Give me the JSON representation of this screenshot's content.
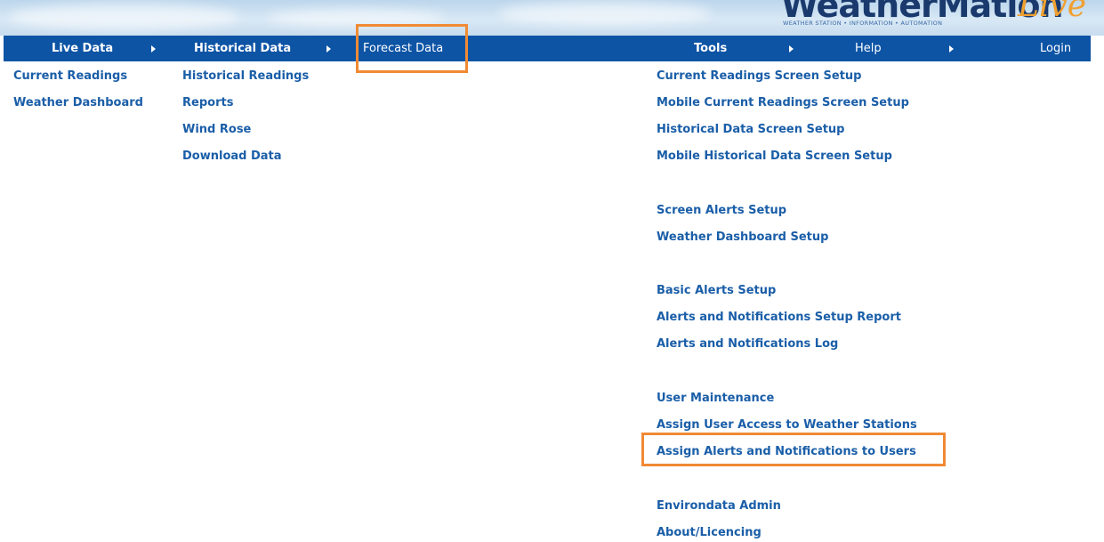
{
  "logo": {
    "main": "WeatherMation",
    "live": "Live",
    "tagline": "WEATHER STATION • INFORMATION • AUTOMATION"
  },
  "navbar": {
    "live_data": "Live Data",
    "historical_data": "Historical Data",
    "forecast_data": "Forecast Data",
    "tools": "Tools",
    "help": "Help",
    "login": "Login"
  },
  "live_data_menu": [
    "Current Readings",
    "Weather Dashboard"
  ],
  "historical_menu": [
    "Historical Readings",
    "Reports",
    "Wind Rose",
    "Download Data"
  ],
  "tools_menu": [
    "Current Readings Screen Setup",
    "Mobile Current Readings Screen Setup",
    "Historical Data Screen Setup",
    "Mobile Historical Data Screen Setup",
    "Screen Alerts Setup",
    "Weather Dashboard Setup",
    "Basic Alerts Setup",
    "Alerts and Notifications Setup Report",
    "Alerts and Notifications Log",
    "User Maintenance",
    "Assign User Access to Weather Stations",
    "Assign Alerts and Notifications to Users",
    "Environdata Admin",
    "About/Licencing"
  ],
  "colors": {
    "nav_bg": "#0d54a5",
    "link": "#1a5ea8",
    "highlight": "#f08a34"
  }
}
